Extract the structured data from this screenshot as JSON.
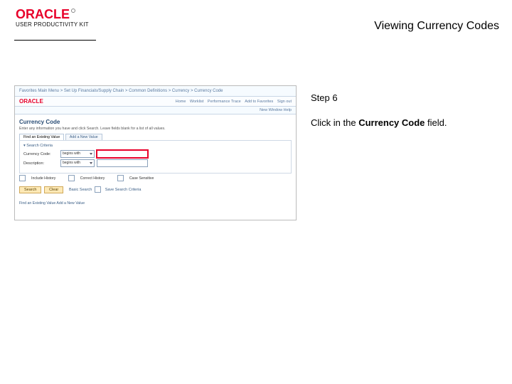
{
  "header": {
    "brand_main": "ORACLE",
    "brand_sub": "USER PRODUCTIVITY KIT",
    "title": "Viewing Currency Codes"
  },
  "instruction": {
    "step": "Step 6",
    "prefix": "Click in the ",
    "bold": "Currency Code",
    "suffix": " field."
  },
  "shot": {
    "crumbs": "Favorites    Main Menu  >  Set Up Financials/Supply Chain  >  Common Definitions  >  Currency  >  Currency Code",
    "brand": "ORACLE",
    "nav": {
      "a": "Home",
      "b": "Worklist",
      "c": "Performance Trace",
      "d": "Add to Favorites",
      "e": "Sign out"
    },
    "newwin": "New Window   Help",
    "title": "Currency Code",
    "help": "Enter any information you have and click Search. Leave fields blank for a list of all values.",
    "tabs": {
      "a": "Find an Existing Value",
      "b": "Add a New Value"
    },
    "box_title": "▾ Search Criteria",
    "rows": {
      "cc_label": "Currency Code:",
      "desc_label": "Description:",
      "begins": "begins with"
    },
    "checks": {
      "a": "Include History",
      "b": "Correct History",
      "c": "Case Sensitive"
    },
    "buttons": {
      "search": "Search",
      "clear": "Clear",
      "basic": "Basic Search",
      "save": "Save Search Criteria"
    },
    "footer": "Find an Existing Value   Add a New Value"
  }
}
